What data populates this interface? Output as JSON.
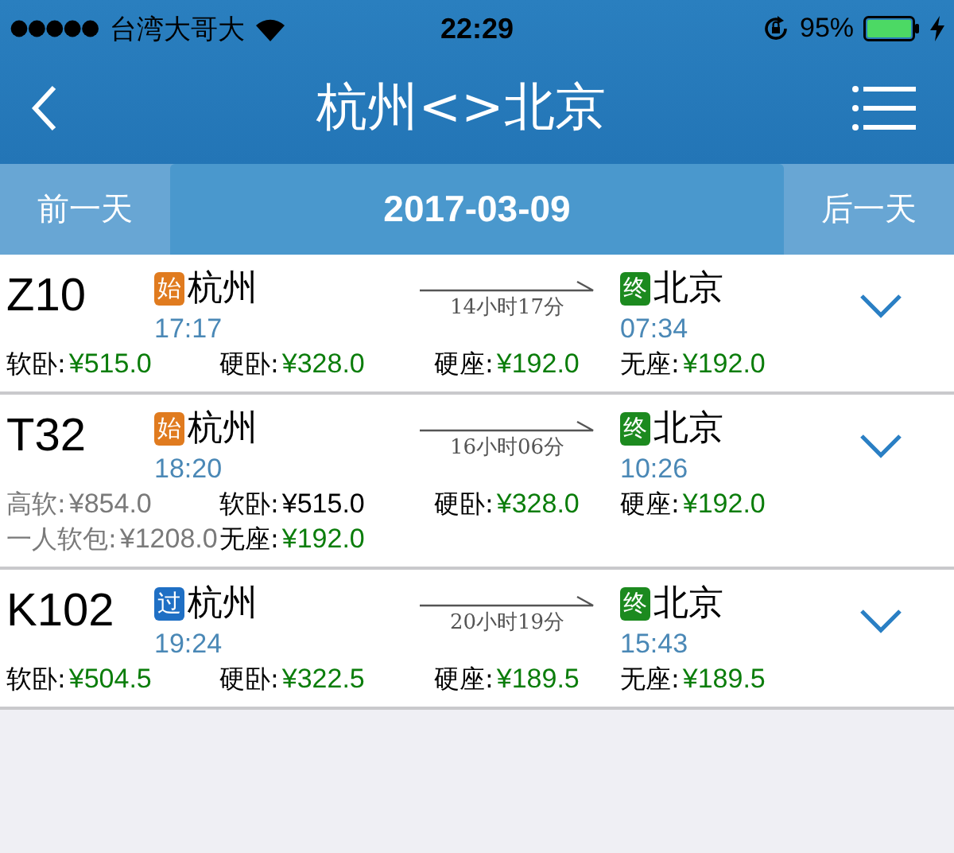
{
  "status_bar": {
    "carrier": "台湾大哥大",
    "time": "22:29",
    "battery": "95%"
  },
  "nav": {
    "title": "杭州<>北京"
  },
  "date_bar": {
    "prev": "前一天",
    "date": "2017-03-09",
    "next": "后一天"
  },
  "trains": [
    {
      "number": "Z10",
      "from": {
        "badge": "始",
        "color": "#e07b1f",
        "station": "杭州",
        "time": "17:17"
      },
      "duration": "14小时17分",
      "to": {
        "badge": "终",
        "color": "#1c8a1f",
        "station": "北京",
        "time": "07:34"
      },
      "fares": [
        {
          "seat": "软卧:",
          "price": "¥515.0",
          "kind": "available"
        },
        {
          "seat": "硬卧:",
          "price": "¥328.0",
          "kind": "available"
        },
        {
          "seat": "硬座:",
          "price": "¥192.0",
          "kind": "available"
        },
        {
          "seat": "无座:",
          "price": "¥192.0",
          "kind": "available"
        }
      ]
    },
    {
      "number": "T32",
      "from": {
        "badge": "始",
        "color": "#e07b1f",
        "station": "杭州",
        "time": "18:20"
      },
      "duration": "16小时06分",
      "to": {
        "badge": "终",
        "color": "#1c8a1f",
        "station": "北京",
        "time": "10:26"
      },
      "fares": [
        {
          "seat": "高软:",
          "price": "¥854.0",
          "kind": "unavailable"
        },
        {
          "seat": "软卧:",
          "price": "¥515.0",
          "kind": "soldout"
        },
        {
          "seat": "硬卧:",
          "price": "¥328.0",
          "kind": "available"
        },
        {
          "seat": "硬座:",
          "price": "¥192.0",
          "kind": "available"
        },
        {
          "seat": "一人软包:",
          "price": "¥1208.0",
          "kind": "unavailable"
        },
        {
          "seat": "无座:",
          "price": "¥192.0",
          "kind": "available"
        }
      ]
    },
    {
      "number": "K102",
      "from": {
        "badge": "过",
        "color": "#1f6fc4",
        "station": "杭州",
        "time": "19:24"
      },
      "duration": "20小时19分",
      "to": {
        "badge": "终",
        "color": "#1c8a1f",
        "station": "北京",
        "time": "15:43"
      },
      "fares": [
        {
          "seat": "软卧:",
          "price": "¥504.5",
          "kind": "available"
        },
        {
          "seat": "硬卧:",
          "price": "¥322.5",
          "kind": "available"
        },
        {
          "seat": "硬座:",
          "price": "¥189.5",
          "kind": "available"
        },
        {
          "seat": "无座:",
          "price": "¥189.5",
          "kind": "available"
        }
      ]
    }
  ]
}
